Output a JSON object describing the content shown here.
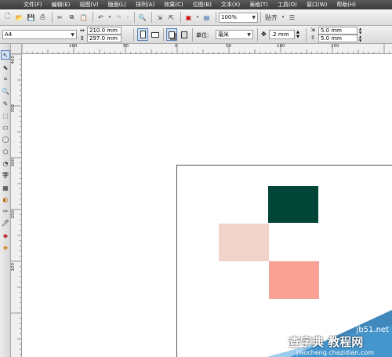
{
  "menu": [
    "文件(F)",
    "编辑(E)",
    "视图(V)",
    "版面(L)",
    "排列(A)",
    "效果(C)",
    "位图(B)",
    "文本(X)",
    "表格(T)",
    "工具(O)",
    "窗口(W)",
    "帮助(H)"
  ],
  "toolbar": {
    "zoom_value": "100%",
    "snap_label": "贴齐"
  },
  "property_bar": {
    "paper_size": "A4",
    "width": "210.0 mm",
    "height": "297.0 mm",
    "units_label": "单位:",
    "units_value": "毫米",
    "nudge": ".2 mm",
    "dup_x": "5.0 mm",
    "dup_y": "5.0 mm"
  },
  "hruler_labels": [
    "100",
    "50",
    "0",
    "50",
    "100",
    "150"
  ],
  "vruler_labels": [
    "400",
    "350",
    "300",
    "250",
    "200"
  ],
  "shapes": [
    {
      "name": "dark-green-rect",
      "color": "#004536"
    },
    {
      "name": "pale-pink-rect",
      "color": "#f0d3c9"
    },
    {
      "name": "salmon-rect",
      "color": "#f8a194"
    }
  ],
  "watermark": {
    "site": "jb51.net",
    "brand": "查字典 教程网",
    "url": "jiaocheng.chazidian.com"
  }
}
